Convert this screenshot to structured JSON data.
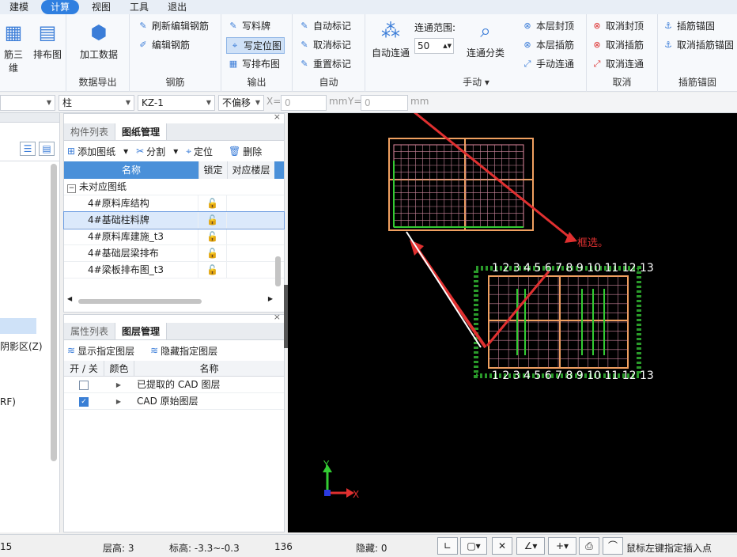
{
  "menu": {
    "items": [
      "建模",
      "计算",
      "视图",
      "工具",
      "退出"
    ]
  },
  "ribbon": {
    "left_partial": [
      "筋三维",
      "排布图"
    ],
    "data_export": {
      "label": "数据导出",
      "big_button": "加工数据"
    },
    "rebar": {
      "label": "钢筋",
      "items": [
        "刷新编辑钢筋",
        "编辑钢筋"
      ]
    },
    "output": {
      "label": "输出",
      "items": [
        "写料牌",
        "写定位图",
        "写排布图"
      ]
    },
    "auto": {
      "label": "自动",
      "items": [
        "自动标记",
        "取消标记",
        "重置标记"
      ]
    },
    "manual": {
      "label": "手动",
      "auto_connect": "自动连通",
      "range_label": "连通范围:",
      "range_value": "50",
      "connect_class": "连通分类",
      "items": [
        "本层封顶",
        "本层插筋",
        "手动连通"
      ]
    },
    "cancel": {
      "label": "取消",
      "items": [
        "取消封顶",
        "取消插筋",
        "取消连通"
      ]
    },
    "anchor": {
      "label": "插筋锚固",
      "items": [
        "插筋锚固",
        "取消插筋锚固"
      ]
    }
  },
  "toolbar2": {
    "type": "柱",
    "name": "KZ-1",
    "offset": "不偏移",
    "x_label": "X=",
    "x_value": "0",
    "unit1": "mm",
    "y_label": "Y=",
    "y_value": "0",
    "unit2": "mm"
  },
  "left_pane": {
    "items": [
      "阴影区(Z)",
      "RF)"
    ]
  },
  "drawing_panel": {
    "tabs": [
      "构件列表",
      "图纸管理"
    ],
    "tools": [
      "添加图纸",
      "分割",
      "定位",
      "删除"
    ],
    "columns": [
      "名称",
      "锁定",
      "对应楼层"
    ],
    "group": "未对应图纸",
    "rows": [
      "4#原料库结构",
      "4#基础柱料牌",
      "4#原料库建施_t3",
      "4#基础层梁排布",
      "4#梁板排布图_t3"
    ]
  },
  "layer_panel": {
    "tabs": [
      "属性列表",
      "图层管理"
    ],
    "tools": [
      "显示指定图层",
      "隐藏指定图层"
    ],
    "columns": [
      "开 / 关",
      "颜色",
      "名称"
    ],
    "rows": [
      {
        "name": "已提取的 CAD 图层",
        "checked": false
      },
      {
        "name": "CAD 原始图层",
        "checked": true
      }
    ]
  },
  "canvas": {
    "annotation": "框选。",
    "axis_x": "X",
    "axis_y": "Y",
    "grid_labels": "1 2 3 4 5 6 7 8 9 10 11 12 13"
  },
  "statusbar": {
    "left": "15",
    "floor_height_label": "层高:",
    "floor_height": "3",
    "elev_label": "标高:",
    "elev": "-3.3~-0.3",
    "count": "136",
    "hidden_label": "隐藏:",
    "hidden": "0",
    "hint": "鼠标左键指定插入点"
  }
}
